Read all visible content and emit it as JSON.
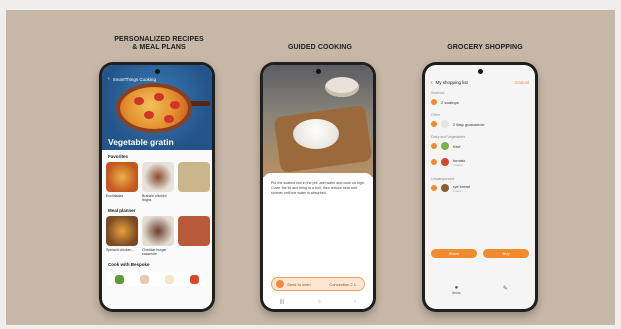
{
  "captions": {
    "left": [
      "PERSONALIZED RECIPES",
      "& MEAL PLANS"
    ],
    "middle": "GUIDED COOKING",
    "right": "GROCERY SHOPPING"
  },
  "phone1": {
    "app_title": "SmartThings Cooking",
    "hero_title": "Vegetable gratin",
    "favorites_label": "Favorites",
    "favorites": [
      "Enchiladas",
      "Braised chicken thighs",
      ""
    ],
    "meal_planner_label": "Meal planner",
    "meal_planner": [
      "Spinach chicken…",
      "Cheddar burger casserole",
      ""
    ],
    "cook_with_label": "Cook with Bespoke",
    "colors": {
      "hero": "#24558a",
      "accent": "#f08a3c"
    }
  },
  "phone2": {
    "step_text": "Put the soaked rice in the pot, add water and cook on high. Cover the lid and bring to a boil, then reduce heat and simmer until the water is absorbed.",
    "send_label": "Send to oven",
    "send_value": "Convection 2 1…"
  },
  "phone3": {
    "title": "My shopping list",
    "cancel": "Cancel",
    "groups": [
      "Seafood",
      "Other",
      "Dairy and Vegetables",
      "Uncategorized"
    ],
    "items": [
      {
        "name": "2 scallops",
        "note": ""
      },
      {
        "name": "2 tbsp guacamole",
        "note": ""
      },
      {
        "name": "Kiwi",
        "note": ""
      },
      {
        "name": "tomato",
        "note": "3 items"
      },
      {
        "name": "rye bread",
        "note": "1 item"
      }
    ],
    "btn_left": "Share",
    "btn_right": "Buy",
    "nav": [
      "Items",
      ""
    ]
  }
}
